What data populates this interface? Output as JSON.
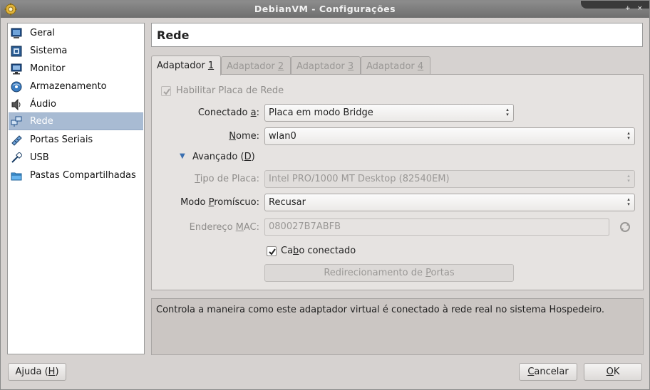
{
  "window": {
    "title": "DebianVM - Configurações",
    "controls": [
      "+",
      "×"
    ]
  },
  "sidebar": {
    "items": [
      {
        "label": "Geral",
        "icon": "general-icon"
      },
      {
        "label": "Sistema",
        "icon": "system-icon"
      },
      {
        "label": "Monitor",
        "icon": "monitor-icon"
      },
      {
        "label": "Armazenamento",
        "icon": "storage-icon"
      },
      {
        "label": "Áudio",
        "icon": "audio-icon"
      },
      {
        "label": "Rede",
        "icon": "network-icon",
        "selected": true
      },
      {
        "label": "Portas Seriais",
        "icon": "serial-ports-icon"
      },
      {
        "label": "USB",
        "icon": "usb-icon"
      },
      {
        "label": "Pastas Compartilhadas",
        "icon": "shared-folders-icon"
      }
    ]
  },
  "header": {
    "title": "Rede"
  },
  "tabs": [
    {
      "prefix": "Adaptador ",
      "mnemonic": "1",
      "active": true
    },
    {
      "prefix": "Adaptador ",
      "mnemonic": "2"
    },
    {
      "prefix": "Adaptador ",
      "mnemonic": "3"
    },
    {
      "prefix": "Adaptador ",
      "mnemonic": "4"
    }
  ],
  "form": {
    "enable": {
      "label": "Habilitar Placa de Rede",
      "checked": true,
      "disabled": true
    },
    "attached": {
      "label_pre": "Conectado ",
      "label_mn": "a",
      "label_post": ":",
      "value": "Placa em modo Bridge"
    },
    "name": {
      "label_mn": "N",
      "label_post": "ome:",
      "value": "wlan0"
    },
    "advanced": {
      "label_pre": "Avançado (",
      "label_mn": "D",
      "label_post": ")"
    },
    "adapter_type": {
      "label_mn": "T",
      "label_post": "ipo de Placa:",
      "value": "Intel PRO/1000 MT Desktop (82540EM)",
      "disabled": true
    },
    "promiscuous": {
      "label_pre": "Modo ",
      "label_mn": "P",
      "label_post": "romíscuo:",
      "value": "Recusar"
    },
    "mac": {
      "label_pre": "Endereço ",
      "label_mn": "M",
      "label_post": "AC:",
      "value": "080027B7ABFB",
      "disabled": true
    },
    "cable": {
      "label_pre": "Ca",
      "label_mn": "b",
      "label_post": "o conectado",
      "checked": true
    },
    "port_forwarding": {
      "label_pre": "Redirecionamento de ",
      "label_mn": "P",
      "label_post": "ortas",
      "disabled": true
    }
  },
  "description": "Controla a maneira como este adaptador virtual é conectado à rede real no sistema Hospedeiro.",
  "buttons": {
    "help": {
      "pre": "Ajuda (",
      "mn": "H",
      "post": ")"
    },
    "cancel": {
      "mn": "C",
      "post": "ancelar"
    },
    "ok": {
      "mn": "O",
      "post": "K"
    }
  },
  "colors": {
    "selection": "#a8bbd3",
    "window_bg": "#d6d2d0",
    "titlebar": "#7c7c7c"
  }
}
